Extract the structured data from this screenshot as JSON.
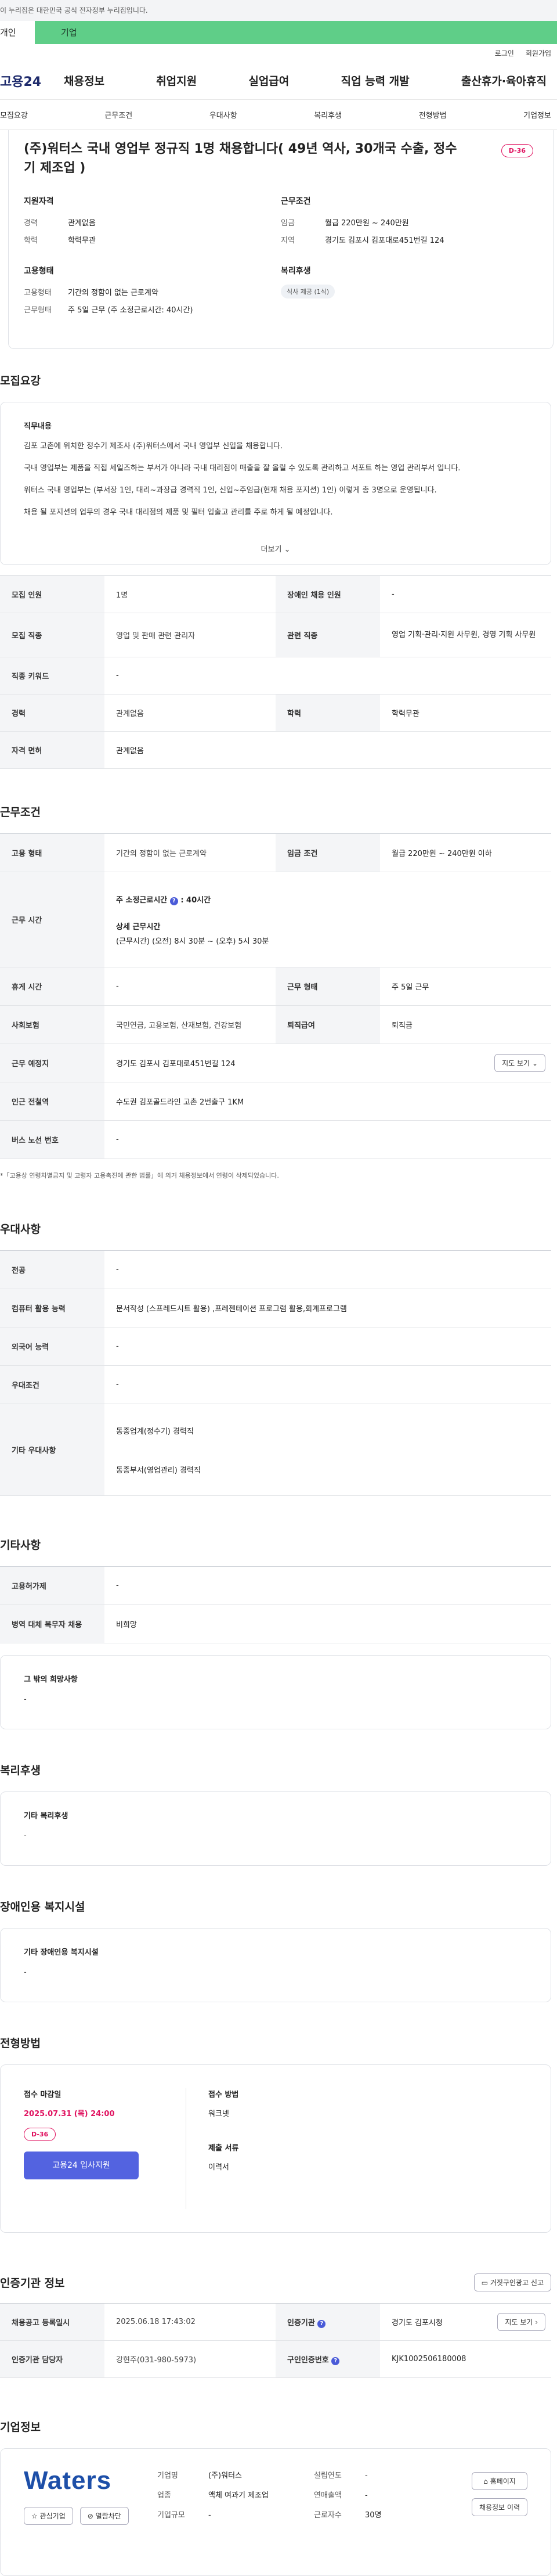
{
  "gov_banner": "이 누리집은 대한민국 공식 전자정부 누리집입니다.",
  "user_tabs": {
    "personal": "개인",
    "corporate": "기업"
  },
  "util": {
    "login": "로그인",
    "join": "회원가입"
  },
  "gnb": {
    "logo": "고용24",
    "menu": [
      "채용정보",
      "취업지원",
      "실업급여",
      "직업 능력 개발",
      "출산휴가·육아휴직"
    ]
  },
  "anchors": [
    "모집요강",
    "근무조건",
    "우대사항",
    "복리후생",
    "전형방법",
    "기업정보"
  ],
  "summary": {
    "title": "(주)워터스 국내 영업부 정규직 1명 채용합니다( 49년 역사, 30개국 수출, 정수기 제조업 )",
    "dday": "D-36",
    "qual_title": "지원자격",
    "qual": [
      {
        "k": "경력",
        "v": "관계없음"
      },
      {
        "k": "학력",
        "v": "학력무관"
      }
    ],
    "cond_title": "근무조건",
    "cond": [
      {
        "k": "임금",
        "v": "월급 220만원 ~ 240만원"
      },
      {
        "k": "지역",
        "v": "경기도 김포시 김포대로451번길 124"
      }
    ],
    "type_title": "고용형태",
    "type": [
      {
        "k": "고용형태",
        "v": "기간의 정함이 없는 근로계약"
      },
      {
        "k": "근무형태",
        "v": "주 5일 근무 (주 소정근로시간: 40시간)"
      }
    ],
    "welfare_title": "복리후생",
    "welfare_chip": "식사 제공 (1식)"
  },
  "recruit": {
    "title": "모집요강",
    "job_title": "직무내용",
    "lines": [
      "김포 고촌에 위치한 정수기 제조사 (주)워터스에서 국내 영업부 신입을 채용합니다.",
      "국내 영업부는 제품을 직접 세일즈하는 부서가 아니라 국내 대리점이 매출을 잘 올릴 수 있도록 관리하고 서포트 하는 영업 관리부서 입니다.",
      "워터스 국내 영업부는 (부서장 1인, 대리~과장급 경력직 1인, 신입~주임급(현재 채용 포지션) 1인) 이렇게 총 3명으로 운영됩니다.",
      "채용 될 포지션의 업무의 경우 국내 대리점의 제품 및 필터 입출고 관리를 주로 하게 될 예정입니다."
    ],
    "more": "더보기",
    "rows": [
      {
        "k1": "모집 인원",
        "v1": "1명",
        "k2": "장애인 채용 인원",
        "v2": "-"
      },
      {
        "k1": "모집 직종",
        "v1": "영업 및 판매 관련 관리자",
        "k2": "관련 직종",
        "v2": "영업 기획·관리·지원 사무원, 경영 기획 사무원"
      },
      {
        "k1": "직종 키워드",
        "v1": "-"
      },
      {
        "k1": "경력",
        "v1": "관계없음",
        "k2": "학력",
        "v2": "학력무관"
      },
      {
        "k1": "자격 면허",
        "v1": "관계없음"
      }
    ]
  },
  "work": {
    "title": "근무조건",
    "employ_k": "고용 형태",
    "employ_v": "기간의 정함이 없는 근로계약",
    "wage_k": "임금 조건",
    "wage_v": "월급 220만원 ~ 240만원 이하",
    "time_k": "근무 시간",
    "time_week": "주 소정근로시간",
    "time_week_v": ": 40시간",
    "time_detail_t": "상세 근무시간",
    "time_detail_v": "(근무시간) (오전) 8시 30분 ~ (오후) 5시 30분",
    "rest_k": "휴게 시간",
    "rest_v": "-",
    "form_k": "근무 형태",
    "form_v": "주 5일 근무",
    "ins_k": "사회보험",
    "ins_v": "국민연금, 고용보험, 산재보험, 건강보험",
    "ret_k": "퇴직급여",
    "ret_v": "퇴직금",
    "place_k": "근무 예정지",
    "place_v": "경기도 김포시 김포대로451번길 124",
    "map_btn": "지도 보기",
    "subway_k": "인근 전철역",
    "subway_v": "수도권 김포골드라인 고촌 2번출구 1KM",
    "bus_k": "버스 노선 번호",
    "bus_v": "-",
    "note": "*「고용상 연령차별금지 및 고령자 고용촉진에 관한 법률」에 의거 채용정보에서 연령이 삭제되었습니다."
  },
  "pref": {
    "title": "우대사항",
    "rows": [
      {
        "k": "전공",
        "v": "-"
      },
      {
        "k": "컴퓨터 활용 능력",
        "v": "문서작성 (스프레드시트 활용) ,프레젠테이션 프로그램 활용,회계프로그램"
      },
      {
        "k": "외국어 능력",
        "v": "-"
      },
      {
        "k": "우대조건",
        "v": "-"
      }
    ],
    "etc_k": "기타 우대사항",
    "etc_v1": "동종업계(정수기) 경력직",
    "etc_v2": "동종부서(영업관리) 경력직"
  },
  "other": {
    "title": "기타사항",
    "rows": [
      {
        "k": "고용허가제",
        "v": "-"
      },
      {
        "k": "병역 대체 복무자 채용",
        "v": "비희망"
      }
    ],
    "box_t": "그 밖의 희망사항",
    "box_v": "-"
  },
  "welfare": {
    "title": "복리후생",
    "box_t": "기타 복리후생",
    "box_v": "-"
  },
  "disab": {
    "title": "장애인용 복지시설",
    "box_t": "기타 장애인용 복지시설",
    "box_v": "-"
  },
  "process": {
    "title": "전형방법",
    "deadline_t": "접수 마감일",
    "deadline_v": "2025.07.31 (목) 24:00",
    "dday": "D-36",
    "apply_btn": "고용24 입사지원",
    "method_t": "접수 방법",
    "method_v": "워크넷",
    "docs_t": "제출 서류",
    "docs_v": "이력서"
  },
  "cert": {
    "title": "인증기관 정보",
    "report_btn": "거짓구인광고 신고",
    "reg_k": "채용공고 등록일시",
    "reg_v": "2025.06.18 17:43:02",
    "org_k": "인증기관",
    "org_v": "경기도 김포시청",
    "mgr_k": "인증기관 담당자",
    "mgr_v": "강현주(031-980-5973)",
    "no_k": "구인인증번호",
    "no_v": "KJK1002506180008",
    "map_btn": "지도 보기"
  },
  "company": {
    "title": "기업정보",
    "logo": "Waters",
    "fav_btn": "관심기업",
    "block_btn": "열람차단",
    "left": [
      {
        "k": "기업명",
        "v": "(주)워터스"
      },
      {
        "k": "업종",
        "v": "액체 여과기 제조업"
      },
      {
        "k": "기업규모",
        "v": "-"
      }
    ],
    "right": [
      {
        "k": "설립연도",
        "v": "-"
      },
      {
        "k": "연매출액",
        "v": "-"
      },
      {
        "k": "근로자수",
        "v": "30명"
      }
    ],
    "home_btn": "홈페이지",
    "jobs_btn": "채용정보 이력"
  }
}
